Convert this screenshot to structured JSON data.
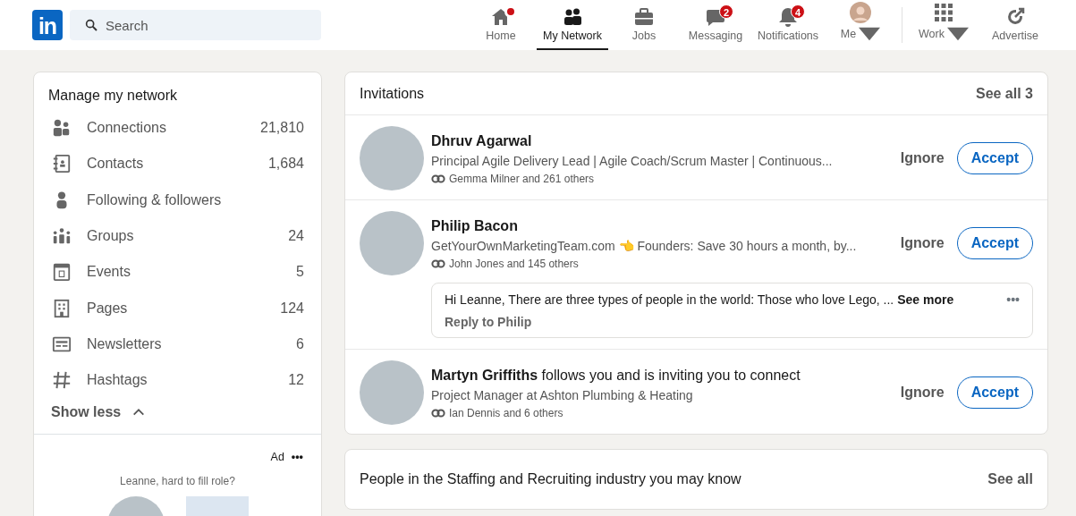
{
  "header": {
    "logo": "in",
    "search": {
      "placeholder": "Search"
    },
    "nav": [
      {
        "kind": "home",
        "label": "Home",
        "selected": false,
        "dot": true,
        "caret": false
      },
      {
        "kind": "network",
        "label": "My Network",
        "selected": true,
        "dot": false,
        "caret": false
      },
      {
        "kind": "jobs",
        "label": "Jobs",
        "selected": false,
        "dot": false,
        "caret": false
      },
      {
        "kind": "messaging",
        "label": "Messaging",
        "selected": false,
        "dot": false,
        "badge": "2",
        "caret": false
      },
      {
        "kind": "notifications",
        "label": "Notifications",
        "selected": false,
        "dot": false,
        "badge": "4",
        "caret": false
      },
      {
        "kind": "me",
        "label": "Me",
        "selected": false,
        "dot": false,
        "caret": true
      },
      {
        "kind": "work",
        "label": "Work",
        "selected": false,
        "dot": false,
        "caret": true
      },
      {
        "kind": "advertise",
        "label": "Advertise",
        "selected": false,
        "dot": false,
        "caret": false
      }
    ]
  },
  "sidebar": {
    "title": "Manage my network",
    "items": [
      {
        "kind": "connections",
        "label": "Connections",
        "count": "21,810"
      },
      {
        "kind": "contacts",
        "label": "Contacts",
        "count": "1,684"
      },
      {
        "kind": "following",
        "label": "Following & followers"
      },
      {
        "kind": "groups",
        "label": "Groups",
        "count": "24"
      },
      {
        "kind": "events",
        "label": "Events",
        "count": "5"
      },
      {
        "kind": "pages",
        "label": "Pages",
        "count": "124"
      },
      {
        "kind": "newsletters",
        "label": "Newsletters",
        "count": "6"
      },
      {
        "kind": "hashtags",
        "label": "Hashtags",
        "count": "12"
      }
    ],
    "toggle": "Show less",
    "expanded": true,
    "ad": {
      "label": "Ad",
      "more": "•••",
      "text": "Leanne, hard to fill role?"
    }
  },
  "invitations": {
    "title": "Invitations",
    "see_all": "See all 3",
    "items": [
      {
        "name": "Dhruv Agarwal",
        "headline": "Principal Agile Delivery Lead | Agile Coach/Scrum Master | Continuous...",
        "mutual": "Gemma Milner and 261 others",
        "ignore": "Ignore",
        "accept": "Accept"
      },
      {
        "name": "Philip Bacon",
        "headline": "GetYourOwnMarketingTeam.com 👈 Founders: Save 30 hours a month, by...",
        "mutual": "John Jones and 145 others",
        "ignore": "Ignore",
        "accept": "Accept",
        "message": {
          "text": "Hi Leanne, There are three types of people in the world: Those who love Lego, ...",
          "see_more": "See more",
          "more": "•••",
          "reply": "Reply to Philip"
        }
      },
      {
        "name": "Martyn Griffiths",
        "suffix": " follows you and is inviting you to connect",
        "headline": "Project Manager at Ashton Plumbing & Heating",
        "mutual": "Ian Dennis and 6 others",
        "ignore": "Ignore",
        "accept": "Accept"
      }
    ]
  },
  "suggestions": {
    "title": "People in the Staffing and Recruiting industry you may know",
    "see_all": "See all"
  }
}
